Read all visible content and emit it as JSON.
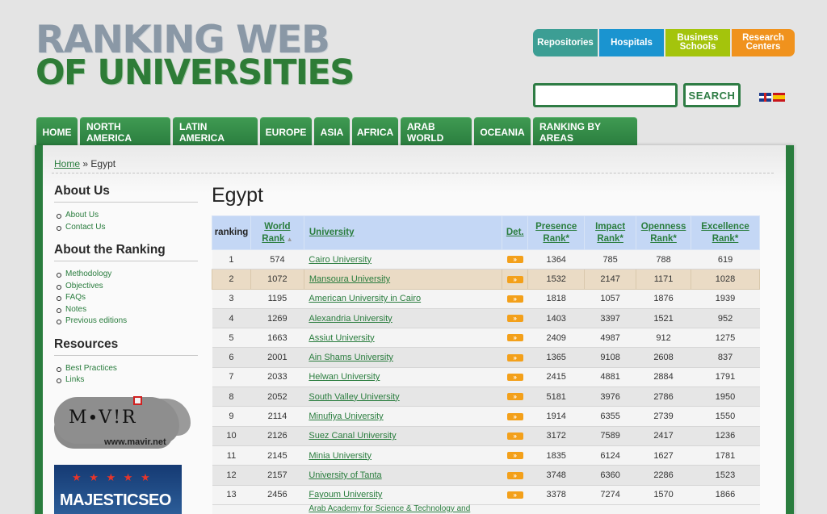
{
  "logo": {
    "line1": "RANKING WEB",
    "line2": "OF UNIVERSITIES"
  },
  "top_buttons": [
    "Repositories",
    "Hospitals",
    "Business Schools",
    "Research Centers"
  ],
  "search": {
    "placeholder": "",
    "button": "SEARCH"
  },
  "languages": [
    "English",
    "Español"
  ],
  "nav": [
    "HOME",
    "NORTH AMERICA",
    "LATIN AMERICA",
    "EUROPE",
    "ASIA",
    "AFRICA",
    "ARAB WORLD",
    "OCEANIA",
    "RANKING BY AREAS"
  ],
  "breadcrumb": {
    "home": "Home",
    "sep": "»",
    "current": "Egypt"
  },
  "sidebar": {
    "about_us": {
      "title": "About Us",
      "items": [
        "About Us",
        "Contact Us"
      ]
    },
    "about_ranking": {
      "title": "About the Ranking",
      "items": [
        "Methodology",
        "Objectives",
        "FAQs",
        "Notes",
        "Previous editions"
      ]
    },
    "resources": {
      "title": "Resources",
      "items": [
        "Best Practices",
        "Links"
      ]
    },
    "mavir": {
      "text": "M∙V!R",
      "url": "www.mavir.net"
    },
    "majestic": {
      "text": "MAJESTICSEO"
    }
  },
  "page_title": "Egypt",
  "table": {
    "headers": {
      "ranking": "ranking",
      "world": "World",
      "rank": "Rank",
      "university": "University",
      "det": "Det.",
      "presence": "Presence",
      "impact": "Impact",
      "openness": "Openness",
      "excellence": "Excellence",
      "rank_star": "Rank*"
    },
    "det_glyph": "»",
    "rows": [
      {
        "ranking": "1",
        "world": "574",
        "university": "Cairo University",
        "presence": "1364",
        "impact": "785",
        "openness": "788",
        "excellence": "619"
      },
      {
        "ranking": "2",
        "world": "1072",
        "university": "Mansoura University",
        "presence": "1532",
        "impact": "2147",
        "openness": "1171",
        "excellence": "1028"
      },
      {
        "ranking": "3",
        "world": "1195",
        "university": "American University in Cairo",
        "presence": "1818",
        "impact": "1057",
        "openness": "1876",
        "excellence": "1939"
      },
      {
        "ranking": "4",
        "world": "1269",
        "university": "Alexandria University",
        "presence": "1403",
        "impact": "3397",
        "openness": "1521",
        "excellence": "952"
      },
      {
        "ranking": "5",
        "world": "1663",
        "university": "Assiut University",
        "presence": "2409",
        "impact": "4987",
        "openness": "912",
        "excellence": "1275"
      },
      {
        "ranking": "6",
        "world": "2001",
        "university": "Ain Shams University",
        "presence": "1365",
        "impact": "9108",
        "openness": "2608",
        "excellence": "837"
      },
      {
        "ranking": "7",
        "world": "2033",
        "university": "Helwan University",
        "presence": "2415",
        "impact": "4881",
        "openness": "2884",
        "excellence": "1791"
      },
      {
        "ranking": "8",
        "world": "2052",
        "university": "South Valley University",
        "presence": "5181",
        "impact": "3976",
        "openness": "2786",
        "excellence": "1950"
      },
      {
        "ranking": "9",
        "world": "2114",
        "university": "Minufiya University",
        "presence": "1914",
        "impact": "6355",
        "openness": "2739",
        "excellence": "1550"
      },
      {
        "ranking": "10",
        "world": "2126",
        "university": "Suez Canal University",
        "presence": "3172",
        "impact": "7589",
        "openness": "2417",
        "excellence": "1236"
      },
      {
        "ranking": "11",
        "world": "2145",
        "university": "Minia University",
        "presence": "1835",
        "impact": "6124",
        "openness": "1627",
        "excellence": "1781"
      },
      {
        "ranking": "12",
        "world": "2157",
        "university": "University of Tanta",
        "presence": "3748",
        "impact": "6360",
        "openness": "2286",
        "excellence": "1523"
      },
      {
        "ranking": "13",
        "world": "2456",
        "university": "Fayoum University",
        "presence": "3378",
        "impact": "7274",
        "openness": "1570",
        "excellence": "1866"
      }
    ],
    "partial_row": "Arab Academy for Science & Technology and"
  }
}
